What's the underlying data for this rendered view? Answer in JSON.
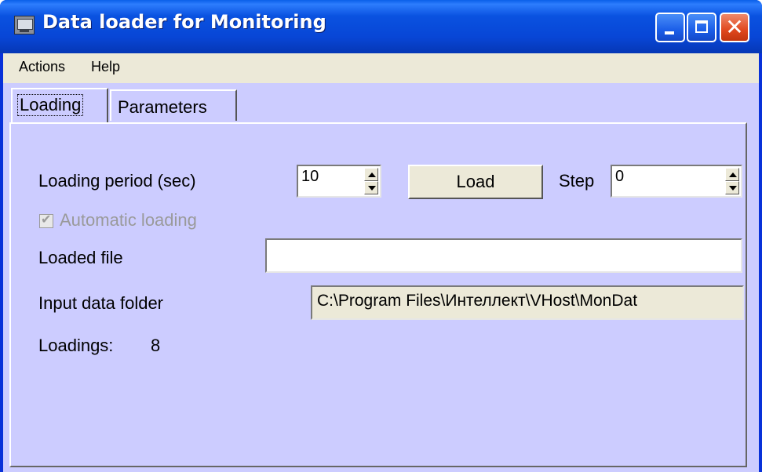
{
  "window": {
    "title": "Data loader for Monitoring"
  },
  "menu": {
    "actions": "Actions",
    "help": "Help"
  },
  "tabs": {
    "loading": "Loading",
    "parameters": "Parameters"
  },
  "form": {
    "loading_period_label": "Loading period (sec)",
    "loading_period_value": "10",
    "load_button": "Load",
    "step_label": "Step",
    "step_value": "0",
    "automatic_loading_label": "Automatic loading",
    "automatic_loading_checked": true,
    "loaded_file_label": "Loaded file",
    "loaded_file_value": "",
    "input_folder_label": "Input data folder",
    "input_folder_value": "C:\\Program Files\\Интеллект\\VHost\\MonDat",
    "loadings_label": "Loadings:",
    "loadings_count": "8"
  },
  "icons": {
    "app": "monitor-icon",
    "minimize": "minimize-icon",
    "maximize": "maximize-icon",
    "close": "close-icon",
    "check": "check-icon"
  }
}
